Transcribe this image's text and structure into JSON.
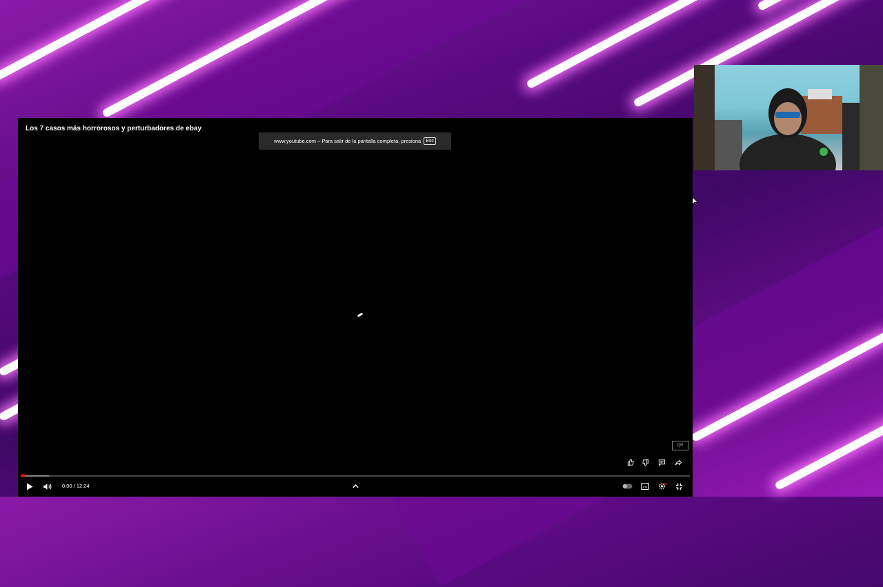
{
  "background": {
    "accent": "#8a1aa8",
    "stripe_color": "#ffffff"
  },
  "player": {
    "title": "Los 7 casos más horrorosos y perturbadores de ebay",
    "fullscreen_notice": "www.youtube.com – Para salir de la pantalla completa, presiona",
    "esc_key": "Esc",
    "watermark": "QR",
    "progress_fraction": 0.0,
    "time_display": "0:00 / 12:24",
    "icons": {
      "like": "thumbs-up-icon",
      "dislike": "thumbs-down-icon",
      "comments": "comment-icon",
      "share": "share-icon",
      "play": "play-icon",
      "volume": "volume-icon",
      "chapters": "chevron-up-icon",
      "autoplay": "autoplay-toggle",
      "subtitles": "subtitles-icon",
      "settings": "gear-icon",
      "exit_fullscreen": "exit-fullscreen-icon"
    },
    "progress_color": "#ff0000"
  }
}
